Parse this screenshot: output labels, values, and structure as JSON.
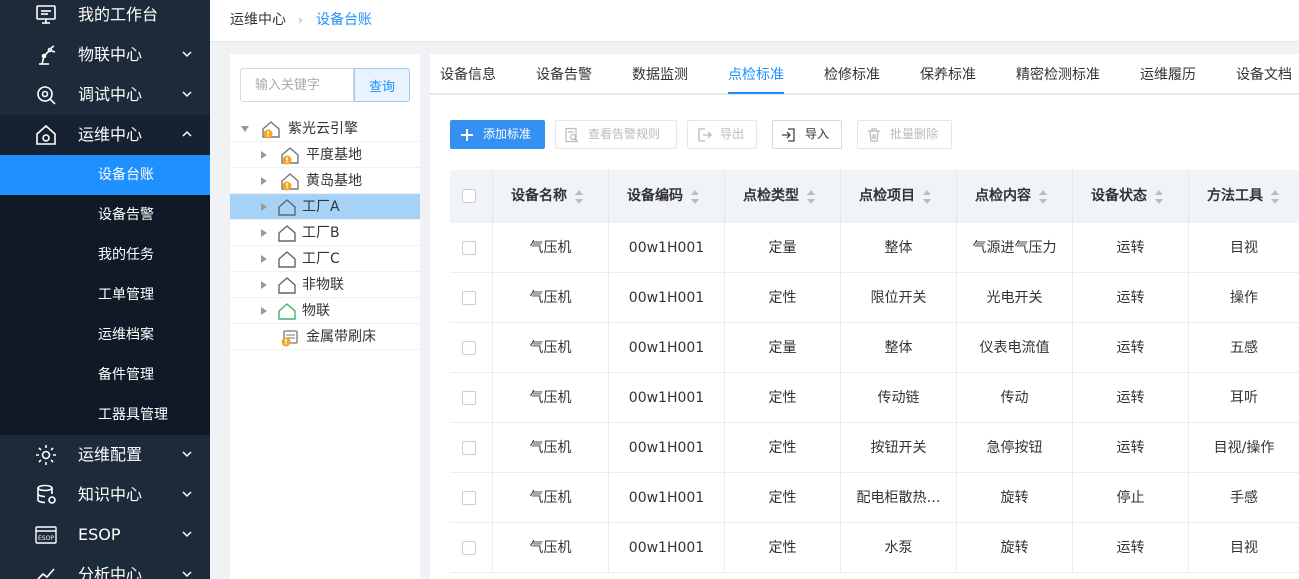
{
  "sidebar": {
    "menus": [
      {
        "label": "我的工作台",
        "icon": "monitor-icon"
      },
      {
        "label": "物联中心",
        "icon": "robot-arm-icon"
      },
      {
        "label": "调试中心",
        "icon": "search-gear-icon"
      },
      {
        "label": "运维中心",
        "icon": "home-gear-icon"
      },
      {
        "label": "运维配置",
        "icon": "gear-icon"
      },
      {
        "label": "知识中心",
        "icon": "database-icon"
      },
      {
        "label": "ESOP",
        "icon": "esop-icon"
      },
      {
        "label": "分析中心",
        "icon": "chart-icon"
      }
    ],
    "submenu": [
      "设备台账",
      "设备告警",
      "我的任务",
      "工单管理",
      "运维档案",
      "备件管理",
      "工器具管理"
    ],
    "esop_badge": "ESOP"
  },
  "breadcrumb": {
    "parent": "运维中心",
    "separator": "›",
    "current": "设备台账"
  },
  "tree": {
    "search_placeholder": "输入关键字",
    "search_button": "查询",
    "nodes": [
      "紫光云引擎",
      "平度基地",
      "黄岛基地",
      "工厂A",
      "工厂B",
      "工厂C",
      "非物联",
      "物联",
      "金属带刷床"
    ]
  },
  "tabs": [
    "设备信息",
    "设备告警",
    "数据监测",
    "点检标准",
    "检修标准",
    "保养标准",
    "精密检测标准",
    "运维履历",
    "设备文档"
  ],
  "toolbar": {
    "add": "添加标准",
    "view_rules": "查看告警规则",
    "export": "导出",
    "import": "导入",
    "batch_delete": "批量删除"
  },
  "table": {
    "headers": [
      "设备名称",
      "设备编码",
      "点检类型",
      "点检项目",
      "点检内容",
      "设备状态",
      "方法工具"
    ],
    "rows": [
      [
        "气压机",
        "00w1H001",
        "定量",
        "整体",
        "气源进气压力",
        "运转",
        "目视"
      ],
      [
        "气压机",
        "00w1H001",
        "定性",
        "限位开关",
        "光电开关",
        "运转",
        "操作"
      ],
      [
        "气压机",
        "00w1H001",
        "定量",
        "整体",
        "仪表电流值",
        "运转",
        "五感"
      ],
      [
        "气压机",
        "00w1H001",
        "定性",
        "传动链",
        "传动",
        "运转",
        "耳听"
      ],
      [
        "气压机",
        "00w1H001",
        "定性",
        "按钮开关",
        "急停按钮",
        "运转",
        "目视/操作"
      ],
      [
        "气压机",
        "00w1H001",
        "定性",
        "配电柜散热…",
        "旋转",
        "停止",
        "手感"
      ],
      [
        "气压机",
        "00w1H001",
        "定性",
        "水泵",
        "旋转",
        "运转",
        "目视"
      ]
    ]
  },
  "colors": {
    "accent": "#1e90ff",
    "sidebar": "#1d2a3a",
    "warning": "#f5a623",
    "iot_green": "#3cb371"
  }
}
